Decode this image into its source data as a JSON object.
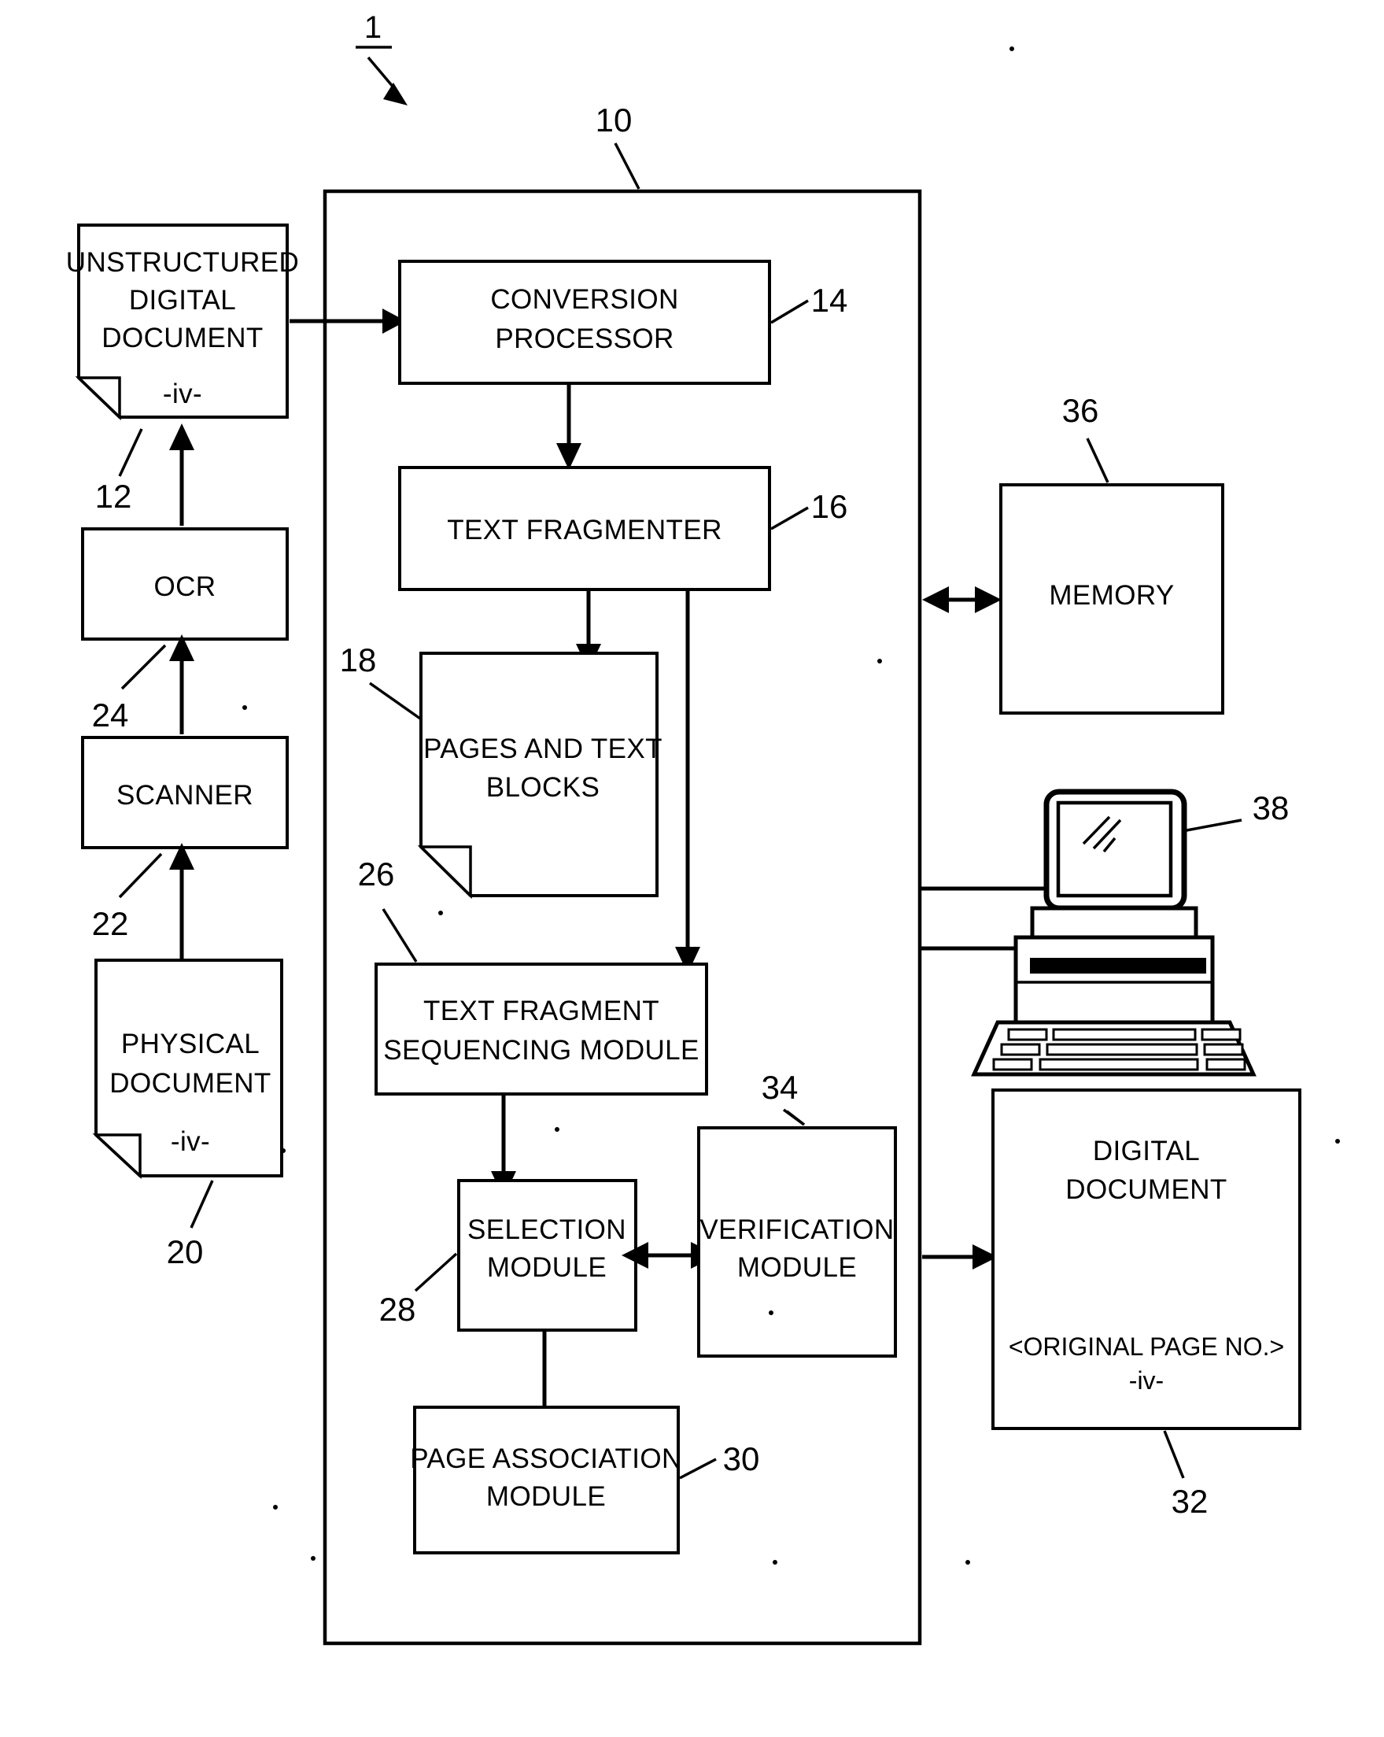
{
  "figure": {
    "number": "1",
    "system_label": "10"
  },
  "nodes": {
    "unstructured_digital_document": {
      "line1": "UNSTRUCTURED",
      "line2": "DIGITAL",
      "line3": "DOCUMENT",
      "page_marker": "-iv-",
      "ref": "12"
    },
    "ocr": {
      "label": "OCR",
      "ref": "24"
    },
    "scanner": {
      "label": "SCANNER",
      "ref": "22"
    },
    "physical_document": {
      "line1": "PHYSICAL",
      "line2": "DOCUMENT",
      "page_marker": "-iv-",
      "ref": "20"
    },
    "conversion_processor": {
      "line1": "CONVERSION",
      "line2": "PROCESSOR",
      "ref": "14"
    },
    "text_fragmenter": {
      "label": "TEXT FRAGMENTER",
      "ref": "16"
    },
    "pages_and_text_blocks": {
      "line1": "PAGES AND TEXT",
      "line2": "BLOCKS",
      "ref": "18"
    },
    "text_fragment_sequencing_module": {
      "line1": "TEXT FRAGMENT",
      "line2": "SEQUENCING MODULE",
      "ref": "26"
    },
    "selection_module": {
      "line1": "SELECTION",
      "line2": "MODULE",
      "ref": "28"
    },
    "verification_module": {
      "line1": "VERIFICATION",
      "line2": "MODULE",
      "ref": "34"
    },
    "page_association_module": {
      "line1": "PAGE ASSOCIATION",
      "line2": "MODULE",
      "ref": "30"
    },
    "memory": {
      "label": "MEMORY",
      "ref": "36"
    },
    "computer": {
      "ref": "38"
    },
    "digital_document": {
      "line1": "DIGITAL",
      "line2": "DOCUMENT",
      "line3": "<ORIGINAL PAGE NO.>",
      "page_marker": "-iv-",
      "ref": "32"
    }
  },
  "colors": {
    "ink": "#000000",
    "paper": "#ffffff"
  }
}
